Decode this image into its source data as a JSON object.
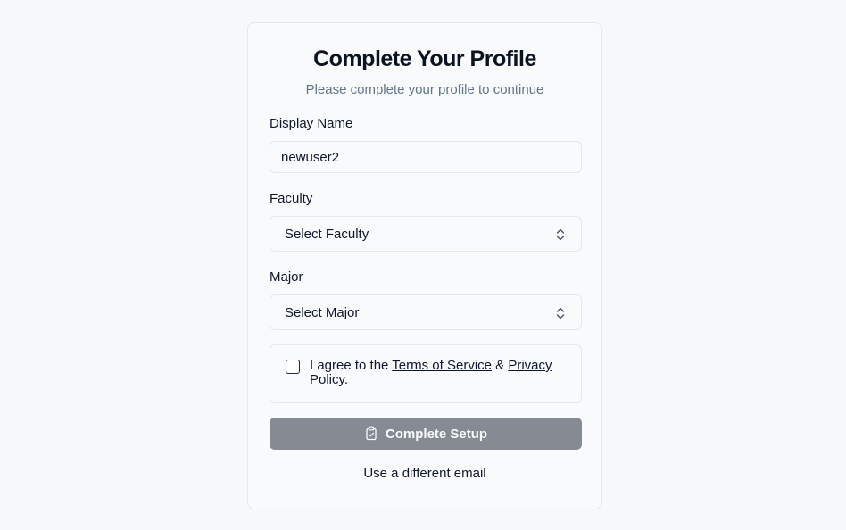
{
  "card": {
    "title": "Complete Your Profile",
    "subtitle": "Please complete your profile to continue"
  },
  "form": {
    "display_name": {
      "label": "Display Name",
      "value": "newuser2"
    },
    "faculty": {
      "label": "Faculty",
      "selected": "Select Faculty",
      "icon": "chevron-up-down-icon"
    },
    "major": {
      "label": "Major",
      "selected": "Select Major",
      "icon": "chevron-up-down-icon"
    },
    "agreement": {
      "checked": false,
      "prefix": "I agree to the ",
      "terms_link": "Terms of Service",
      "joiner": " & ",
      "privacy_link": "Privacy Policy",
      "suffix": "."
    },
    "submit": {
      "label": "Complete Setup",
      "icon": "clipboard-check-icon",
      "disabled": true
    },
    "alt_link": "Use a different email"
  },
  "colors": {
    "page_bg": "#f7f8fa",
    "card_bg": "#f8fafc",
    "border": "#e2e8f0",
    "button_disabled": "#868b93",
    "muted_text": "#64748b"
  }
}
